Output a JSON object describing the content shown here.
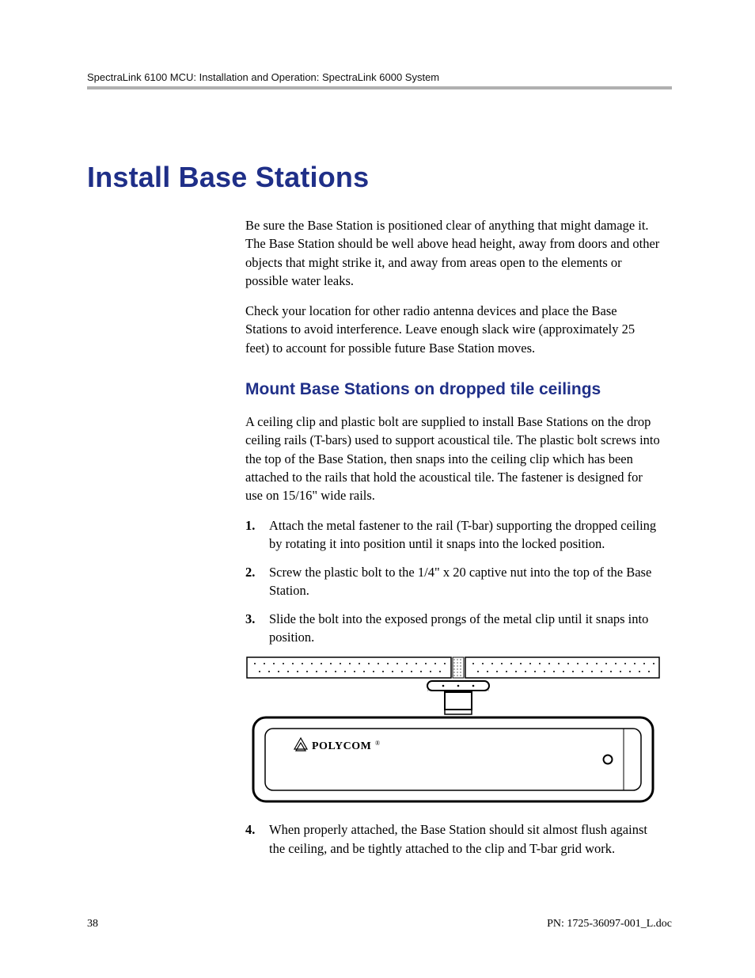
{
  "header": {
    "running_head": "SpectraLink 6100 MCU: Installation and Operation: SpectraLink 6000 System"
  },
  "headings": {
    "main": "Install Base Stations",
    "sub1": "Mount Base Stations on dropped tile ceilings"
  },
  "paragraphs": {
    "intro1": "Be sure the Base Station is positioned clear of anything that might damage it. The Base Station should be well above head height, away from doors and other objects that might strike it, and away from areas open to the elements or possible water leaks.",
    "intro2": "Check your location for other radio antenna devices and place the Base Stations to avoid interference. Leave enough slack wire (approximately 25 feet) to account for possible future Base Station moves.",
    "mount_intro": "A ceiling clip and plastic bolt are supplied to install Base Stations on the drop ceiling rails (T-bars) used to support acoustical tile. The plastic bolt screws into the top of the Base Station, then snaps into the ceiling clip which has been attached to the rails that hold the acoustical tile. The fastener is designed for use on 15/16\" wide rails."
  },
  "steps": [
    "Attach the metal fastener to the rail (T-bar) supporting the dropped ceiling by rotating it into position until it snaps into the locked position.",
    "Screw the plastic bolt to the 1/4\" x 20 captive nut into the top of the Base Station.",
    "Slide the bolt into the exposed prongs of the metal clip until it snaps into position.",
    "When properly attached, the Base Station should sit almost flush against the ceiling, and be tightly attached to the clip and T-bar grid work."
  ],
  "figure": {
    "brand_text": "POLYCOM"
  },
  "footer": {
    "page_number": "38",
    "part_number": "PN: 1725-36097-001_L.doc"
  }
}
